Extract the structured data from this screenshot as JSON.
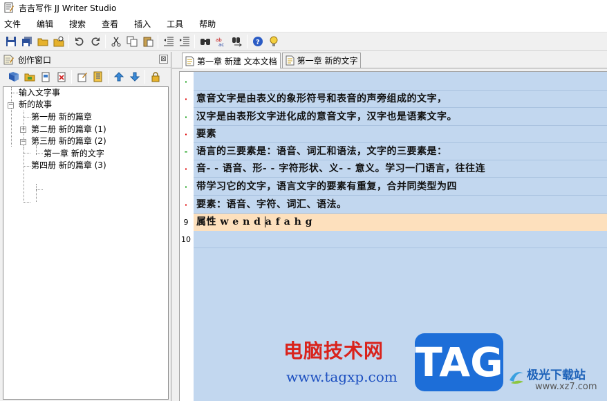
{
  "window": {
    "title": "吉吉写作 JJ Writer Studio"
  },
  "menu": [
    "文件",
    "编辑",
    "搜索",
    "查看",
    "插入",
    "工具",
    "帮助"
  ],
  "left_panel": {
    "title": "创作窗口",
    "close": "⊠",
    "tree": [
      {
        "label": "输入文字事",
        "level": 0
      },
      {
        "label": "新的故事",
        "level": 0,
        "expander": "−"
      },
      {
        "label": "第一册 新的篇章",
        "level": 1
      },
      {
        "label": "第二册 新的篇章 (1)",
        "level": 1,
        "expander": "+"
      },
      {
        "label": "第三册 新的篇章 (2)",
        "level": 1,
        "expander": "−"
      },
      {
        "label": "第一章 新的文字",
        "level": 2
      },
      {
        "label": "第四册 新的篇章 (3)",
        "level": 1
      }
    ]
  },
  "tabs": [
    {
      "label": "第一章 新建 文本文档",
      "active": true
    },
    {
      "label": "第一章 新的文字",
      "active": false
    }
  ],
  "editor": {
    "lines": [
      {
        "marker": "·",
        "marker_color": "green",
        "text": ""
      },
      {
        "marker": "·",
        "marker_color": "red",
        "text": "意音文字是由表义的象形符号和表音的声旁组成的文字，"
      },
      {
        "marker": "·",
        "marker_color": "green",
        "text": "汉字是由表形文字进化成的意音文字，汉字也是语素文字。"
      },
      {
        "marker": "·",
        "marker_color": "red",
        "text": "要素"
      },
      {
        "marker": "-",
        "marker_color": "green",
        "text": "语言的三要素是：语音、词汇和语法，文字的三要素是："
      },
      {
        "marker": "·",
        "marker_color": "red",
        "text": "音- - 语音、形- - 字符形状、义- - 意义。学习一门语言，往往连"
      },
      {
        "marker": "·",
        "marker_color": "green",
        "text": "带学习它的文字，语言文字的要素有重复，合并同类型为四"
      },
      {
        "marker": "·",
        "marker_color": "red",
        "text": "要素：语音、字符、词汇、语法。"
      },
      {
        "marker": "9",
        "marker_color": "black",
        "text_before": "属性  w e n d ",
        "text_after": "a f a h g",
        "current": true
      },
      {
        "marker": "10",
        "marker_color": "black",
        "text": ""
      }
    ]
  },
  "watermark": {
    "brand": "电脑技术网",
    "url": "www.tagxp.com",
    "tag": "TAG",
    "corner_brand": "极光下载站",
    "corner_url": "www.xz7.com"
  },
  "colors": {
    "text_area": "#c2d7ef",
    "current_line": "#fde0bd",
    "marker_red": "#e00000",
    "marker_green": "#1aa01a"
  }
}
